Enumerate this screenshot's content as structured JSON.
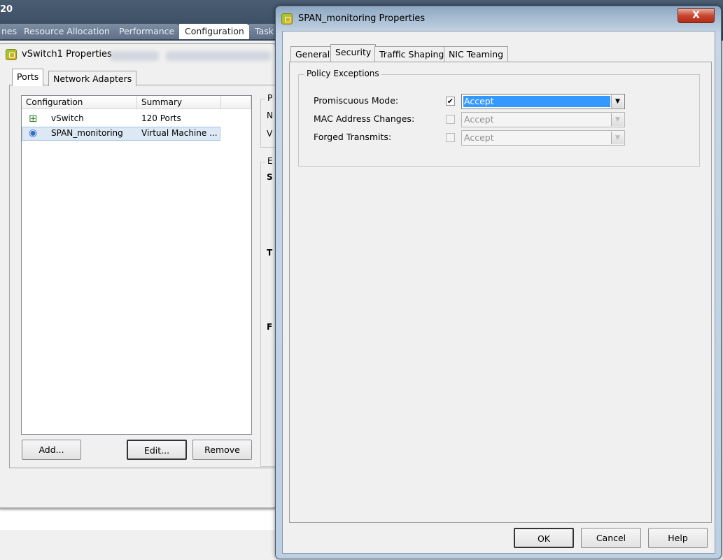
{
  "app": {
    "title": "20",
    "tabs": [
      {
        "label": "nes",
        "active": false
      },
      {
        "label": "Resource Allocation",
        "active": false
      },
      {
        "label": "Performance",
        "active": false
      },
      {
        "label": "Configuration",
        "active": true
      },
      {
        "label": "Task",
        "active": false
      }
    ]
  },
  "vswitch_dialog": {
    "title": "vSwitch1 Properties",
    "tabs": [
      {
        "label": "Ports",
        "active": true
      },
      {
        "label": "Network Adapters",
        "active": false
      }
    ],
    "list": {
      "columns": [
        "Configuration",
        "Summary"
      ],
      "rows": [
        {
          "icon": "vswitch-icon",
          "configuration": "vSwitch",
          "summary": "120 Ports",
          "selected": false
        },
        {
          "icon": "port-group-icon",
          "configuration": "SPAN_monitoring",
          "summary": "Virtual Machine ...",
          "selected": true
        }
      ]
    },
    "buttons": {
      "add": "Add...",
      "edit": "Edit...",
      "remove": "Remove"
    },
    "partial_right": {
      "group1": "P",
      "row1": "N",
      "row2": "V",
      "group2": "E",
      "b1": "S",
      "b2": "T",
      "b3": "F"
    }
  },
  "span_dialog": {
    "title": "SPAN_monitoring Properties",
    "close_label": "X",
    "tabs": [
      {
        "label": "General",
        "active": false
      },
      {
        "label": "Security",
        "active": true
      },
      {
        "label": "Traffic Shaping",
        "active": false
      },
      {
        "label": "NIC Teaming",
        "active": false
      }
    ],
    "group_title": "Policy Exceptions",
    "policies": [
      {
        "label": "Promiscuous Mode:",
        "override": true,
        "value": "Accept",
        "enabled": true
      },
      {
        "label": "MAC Address Changes:",
        "override": false,
        "value": "Accept",
        "enabled": false
      },
      {
        "label": "Forged Transmits:",
        "override": false,
        "value": "Accept",
        "enabled": false
      }
    ],
    "buttons": {
      "ok": "OK",
      "cancel": "Cancel",
      "help": "Help"
    },
    "check_mark": "✔",
    "arrow": "▼"
  }
}
